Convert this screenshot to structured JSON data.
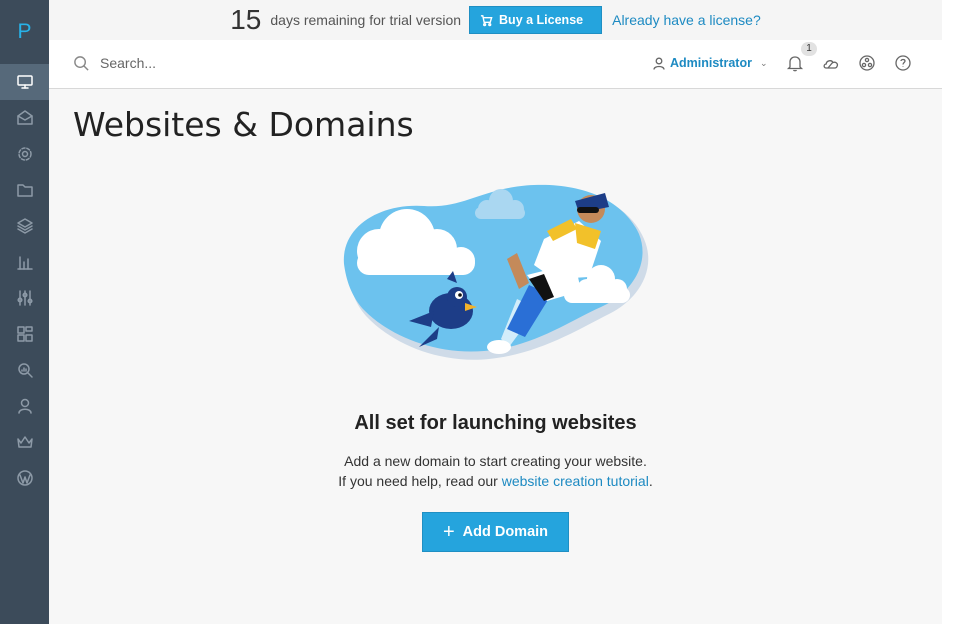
{
  "logo": "P",
  "trial": {
    "days": "15",
    "text": "days remaining for trial version",
    "buy_label": "Buy a License",
    "have_license": "Already have a license?"
  },
  "header": {
    "search_placeholder": "Search...",
    "user": "Administrator",
    "notification_count": "1"
  },
  "sidebar": {
    "items": [
      {
        "name": "websites-domains",
        "icon": "monitor-icon"
      },
      {
        "name": "mail",
        "icon": "mail-icon"
      },
      {
        "name": "applications",
        "icon": "gear-icon"
      },
      {
        "name": "file-manager",
        "icon": "folder-icon"
      },
      {
        "name": "databases",
        "icon": "layers-icon"
      },
      {
        "name": "statistics",
        "icon": "bar-chart-icon"
      },
      {
        "name": "tools-settings",
        "icon": "sliders-icon"
      },
      {
        "name": "extensions",
        "icon": "blocks-icon"
      },
      {
        "name": "seo-toolkit",
        "icon": "search-zoom-icon"
      },
      {
        "name": "users",
        "icon": "user-icon"
      },
      {
        "name": "account",
        "icon": "crown-icon"
      },
      {
        "name": "wordpress",
        "icon": "wordpress-icon"
      }
    ]
  },
  "main": {
    "title": "Websites & Domains",
    "empty_title": "All set for launching websites",
    "empty_line1": "Add a new domain to start creating your website.",
    "empty_line2_prefix": "If you need help, read our ",
    "empty_link": "website creation tutorial",
    "empty_line2_suffix": ".",
    "add_domain_label": "Add Domain"
  },
  "colors": {
    "accent": "#25a4dd",
    "link": "#1d8ac2",
    "sidebar_bg": "#3c4b5a"
  }
}
